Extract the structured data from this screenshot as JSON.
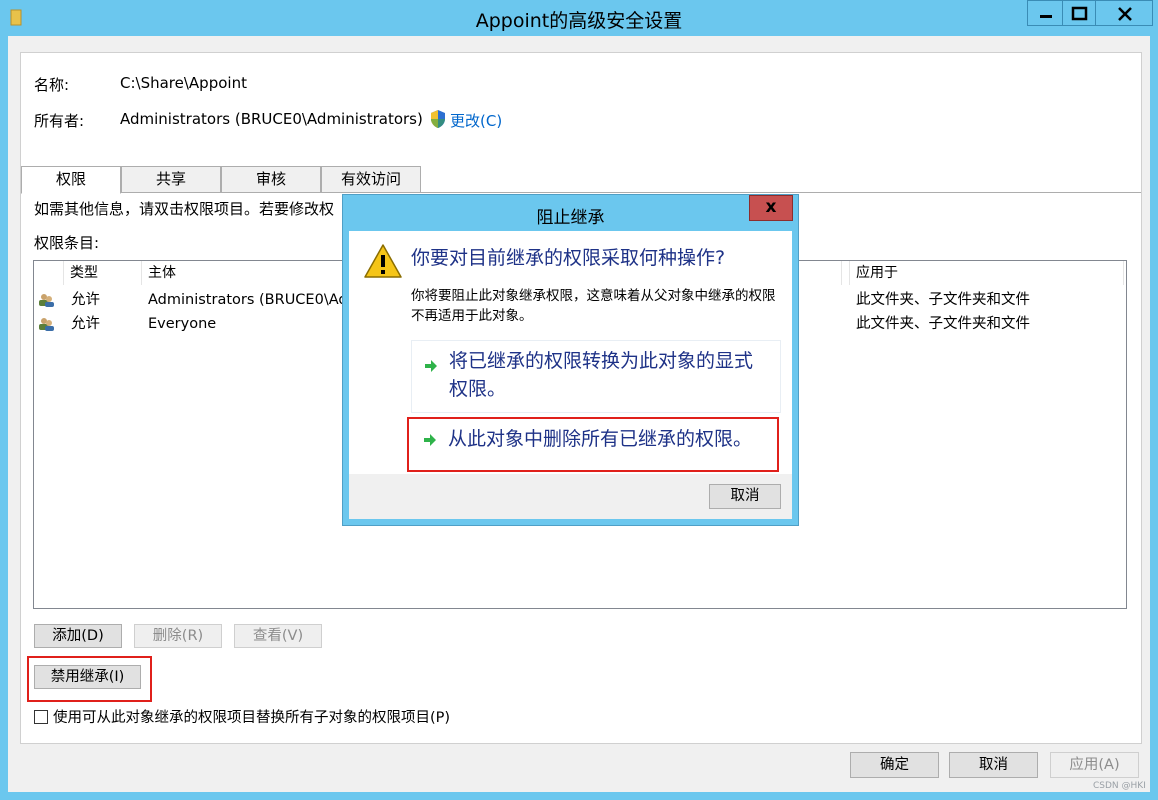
{
  "window": {
    "title": "Appoint的高级安全设置"
  },
  "info": {
    "name_label": "名称:",
    "name_value": "C:\\Share\\Appoint",
    "owner_label": "所有者:",
    "owner_value": "Administrators (BRUCE0\\Administrators)",
    "change_link": "更改(C)"
  },
  "tabs": [
    {
      "label": "权限"
    },
    {
      "label": "共享"
    },
    {
      "label": "审核"
    },
    {
      "label": "有效访问"
    }
  ],
  "permissions": {
    "hint": "如需其他信息，请双击权限项目。若要修改权",
    "entries_label": "权限条目:",
    "columns": {
      "type": "类型",
      "principal": "主体",
      "applies_to": "应用于"
    },
    "rows": [
      {
        "type": "允许",
        "principal": "Administrators (BRUCE0\\Ad",
        "applies_to": "此文件夹、子文件夹和文件"
      },
      {
        "type": "允许",
        "principal": "Everyone",
        "applies_to": "此文件夹、子文件夹和文件"
      }
    ]
  },
  "buttons": {
    "add": "添加(D)",
    "remove": "删除(R)",
    "view": "查看(V)",
    "disable_inheritance": "禁用继承(I)",
    "replace_checkbox_label": "使用可从此对象继承的权限项目替换所有子对象的权限项目(P)",
    "ok": "确定",
    "cancel": "取消",
    "apply": "应用(A)"
  },
  "dialog": {
    "title": "阻止继承",
    "close": "x",
    "question": "你要对目前继承的权限采取何种操作?",
    "description": "你将要阻止此对象继承权限，这意味着从父对象中继承的权限不再适用于此对象。",
    "option1_line1": "将已继承的权限转换为此对象的显式",
    "option1_line2": "权限。",
    "option2": "从此对象中删除所有已继承的权限。",
    "cancel": "取消"
  },
  "watermark": "CSDN @HKI"
}
